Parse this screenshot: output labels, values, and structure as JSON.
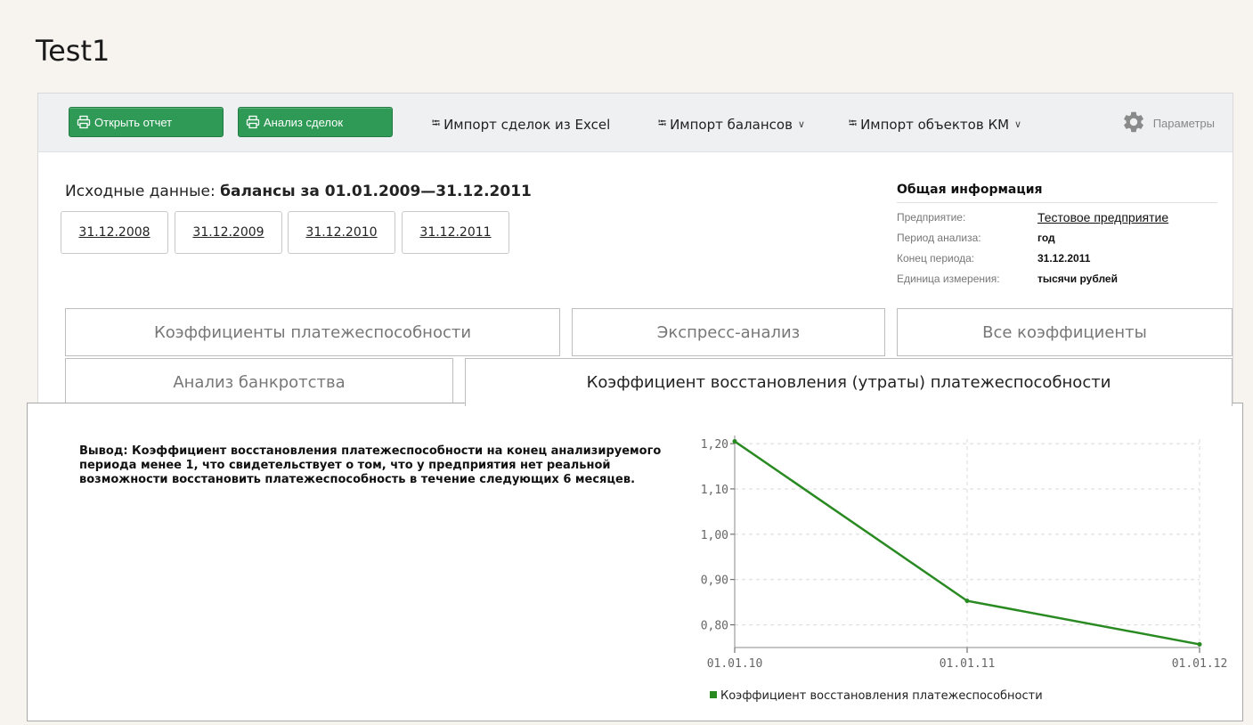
{
  "page": {
    "title": "Test1"
  },
  "toolbar": {
    "open_report": "Открыть отчет",
    "deal_analysis": "Анализ сделок",
    "import_deals": "Импорт сделок из Excel",
    "import_balances": "Импорт балансов",
    "import_objects": "Импорт объектов КМ",
    "parameters": "Параметры"
  },
  "source": {
    "label": "Исходные данные:",
    "value": "балансы за 01.01.2009—31.12.2011",
    "dates": [
      "31.12.2008",
      "31.12.2009",
      "31.12.2010",
      "31.12.2011"
    ]
  },
  "info": {
    "title": "Общая информация",
    "rows": [
      {
        "key": "Предприятие:",
        "value": "Тестовое предприятие"
      },
      {
        "key": "Период анализа:",
        "value": "год"
      },
      {
        "key": "Конец периода:",
        "value": "31.12.2011"
      },
      {
        "key": "Единица измерения:",
        "value": "тысячи рублей"
      }
    ]
  },
  "tabs": {
    "row1": [
      "Коэффициенты платежеспособности",
      "Экспресс-анализ",
      "Все коэффициенты"
    ],
    "row2": [
      "Анализ банкротства",
      "Коэффициент восстановления (утраты) платежеспособности"
    ]
  },
  "conclusion": "Вывод: Коэффициент восстановления платежеспособности на конец анализируемого периода менее 1, что свидетельствует о том, что у предприятия нет реальной возможности восстановить платежеспособность в течение следующих 6 месяцев.",
  "colors": {
    "accent_green": "#2e9a55",
    "line_green": "#2a8a22"
  },
  "icons": {
    "open_report": "printer-icon",
    "deal_analysis": "printer-icon",
    "import": "external-link-icon",
    "parameters": "gear-icon"
  },
  "chart_data": {
    "type": "line",
    "categories": [
      "01.01.10",
      "01.01.11",
      "01.01.12"
    ],
    "series": [
      {
        "name": "Коэффициент восстановления платежеспособности",
        "values": [
          1.205,
          0.853,
          0.757
        ]
      }
    ],
    "yticks": [
      "0,80",
      "0,90",
      "1,00",
      "1,10",
      "1,20"
    ],
    "ytick_values": [
      0.8,
      0.9,
      1.0,
      1.1,
      1.2
    ],
    "ylim": [
      0.75,
      1.21
    ],
    "grid": true,
    "legend": "bottom"
  }
}
